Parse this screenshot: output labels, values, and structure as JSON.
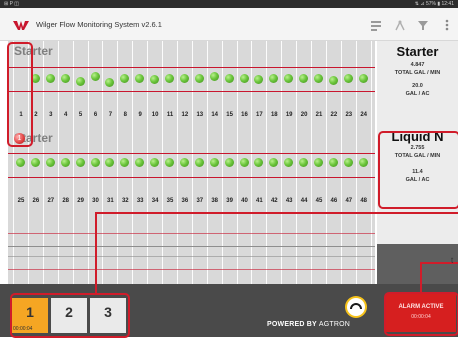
{
  "status_bar": {
    "left_icons": "⊞ P ◫",
    "right": "⇅ ⊿ 57% ▮ 12:41"
  },
  "app": {
    "title": "Wilger Flow Monitoring System v2.6.1"
  },
  "toolbar_icons": [
    "flow-chart-icon",
    "antenna-icon",
    "filter-icon",
    "overflow-menu-icon"
  ],
  "rows": [
    {
      "title": "Starter",
      "numbers": [
        "1",
        "2",
        "3",
        "4",
        "5",
        "6",
        "7",
        "8",
        "9",
        "10",
        "11",
        "12",
        "13",
        "14",
        "15",
        "16",
        "17",
        "18",
        "19",
        "20",
        "21",
        "22",
        "23",
        "24"
      ]
    },
    {
      "title": "Starter",
      "numbers": [
        "25",
        "26",
        "27",
        "28",
        "29",
        "30",
        "31",
        "32",
        "33",
        "34",
        "35",
        "36",
        "37",
        "38",
        "39",
        "40",
        "41",
        "42",
        "43",
        "44",
        "45",
        "46",
        "47",
        "48"
      ]
    }
  ],
  "alarm_row_marker": "1",
  "summary": [
    {
      "name": "Starter",
      "total_value": "4.847",
      "total_label": "TOTAL GAL / MIN",
      "rate_value": "20.0",
      "rate_label": "GAL / AC"
    },
    {
      "name": "Liquid N",
      "total_value": "2.755",
      "total_label": "TOTAL GAL / MIN",
      "rate_value": "11.4",
      "rate_label": "GAL / AC"
    }
  ],
  "tabs": [
    {
      "label": "1",
      "time": "00:00:04",
      "active": true
    },
    {
      "label": "2",
      "time": "",
      "active": false
    },
    {
      "label": "3",
      "time": "",
      "active": false
    }
  ],
  "alarm": {
    "label": "ALARM ACTIVE",
    "time": "00:00:04"
  },
  "powered": {
    "text": "POWERED BY",
    "brand": "AGTRON"
  },
  "side_label": "t",
  "colors": {
    "accent_tab": "#f5a623",
    "alarm": "#d61f1f",
    "annotation": "#d01c2a",
    "flow_ok": "#6cc63c",
    "limit_line": "#c8162e"
  }
}
